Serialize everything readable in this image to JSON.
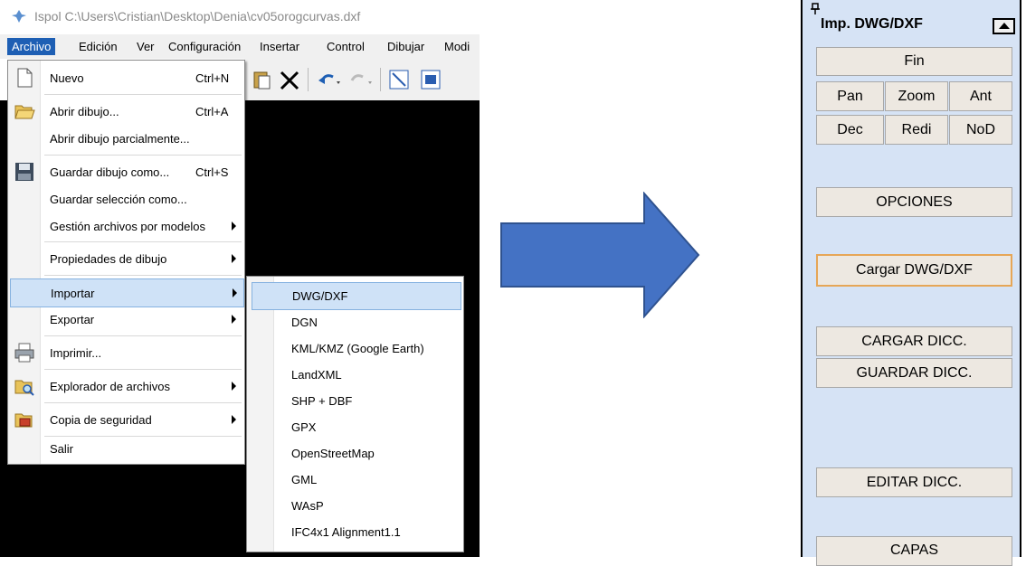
{
  "window": {
    "title": "Ispol  C:\\Users\\Cristian\\Desktop\\Denia\\cv05orogcurvas.dxf"
  },
  "menubar": [
    "Archivo",
    "Edición",
    "Ver",
    "Configuración",
    "Insertar",
    "Control",
    "Dibujar",
    "Modi"
  ],
  "file_menu": {
    "items": [
      {
        "label": "Nuevo",
        "shortcut": "Ctrl+N",
        "icon": "new-document-icon"
      },
      {
        "label": "Abrir dibujo...",
        "shortcut": "Ctrl+A",
        "icon": "open-folder-icon"
      },
      {
        "label": "Abrir dibujo parcialmente..."
      },
      {
        "label": "Guardar dibujo como...",
        "shortcut": "Ctrl+S",
        "icon": "floppy-disk-icon"
      },
      {
        "label": "Guardar selección como..."
      },
      {
        "label": "Gestión archivos por modelos"
      },
      {
        "label": "Propiedades de dibujo"
      },
      {
        "label": "Importar"
      },
      {
        "label": "Exportar"
      },
      {
        "label": "Imprimir...",
        "icon": "printer-icon"
      },
      {
        "label": "Explorador de archivos",
        "icon": "folder-search-icon"
      },
      {
        "label": "Copia de seguridad",
        "icon": "backup-folder-icon"
      },
      {
        "label": "Salir"
      }
    ]
  },
  "import_menu": {
    "items": [
      "DWG/DXF",
      "DGN",
      "KML/KMZ (Google Earth)",
      "LandXML",
      "SHP + DBF",
      "GPX",
      "OpenStreetMap",
      "GML",
      "WAsP",
      "IFC4x1 Alignment1.1"
    ]
  },
  "panel": {
    "title": "Imp. DWG/DXF",
    "buttons": {
      "fin": "Fin",
      "pan": "Pan",
      "zoom": "Zoom",
      "ant": "Ant",
      "dec": "Dec",
      "redi": "Redi",
      "nod": "NoD",
      "opciones": "OPCIONES",
      "cargar_dwg": "Cargar DWG/DXF",
      "cargar_dicc": "CARGAR DICC.",
      "guardar_dicc": "GUARDAR DICC.",
      "editar_dicc": "EDITAR DICC.",
      "capas": "CAPAS"
    }
  },
  "colors": {
    "arrow": "#4472c4",
    "panel_bg": "#d6e3f5",
    "menu_active": "#1e5fb4",
    "highlight": "#cfe2f7",
    "focus_border": "#e6a657"
  }
}
